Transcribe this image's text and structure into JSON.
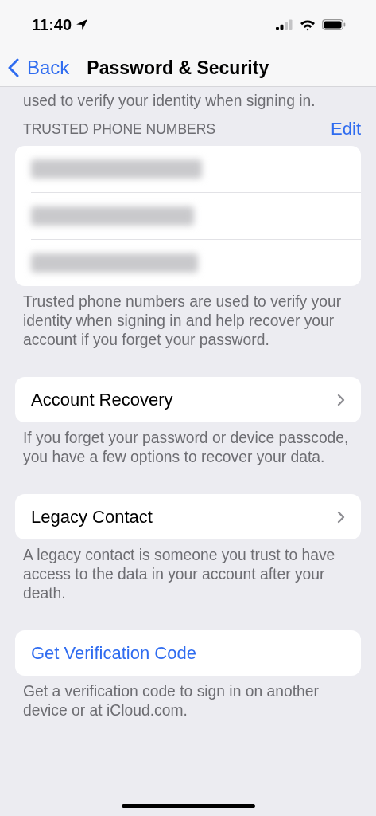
{
  "status_bar": {
    "time": "11:40",
    "location_active": true
  },
  "nav": {
    "back": "Back",
    "title": "Password & Security"
  },
  "intro": "used to verify your identity when signing in.",
  "trusted_numbers": {
    "header": "TRUSTED PHONE NUMBERS",
    "edit": "Edit",
    "rows": [
      {
        "kind": "redacted"
      },
      {
        "kind": "redacted"
      },
      {
        "kind": "redacted"
      }
    ],
    "footer": "Trusted phone numbers are used to verify your identity when signing in and help recover your account if you forget your password."
  },
  "sections": [
    {
      "kind": "disclosure",
      "label": "Account Recovery",
      "footer": "If you forget your password or device passcode, you have a few options to recover your data."
    },
    {
      "kind": "disclosure",
      "label": "Legacy Contact",
      "footer": "A legacy contact is someone you trust to have access to the data in your account after your death."
    },
    {
      "kind": "action",
      "label": "Get Verification Code",
      "footer": "Get a verification code to sign in on another device or at iCloud.com."
    }
  ]
}
